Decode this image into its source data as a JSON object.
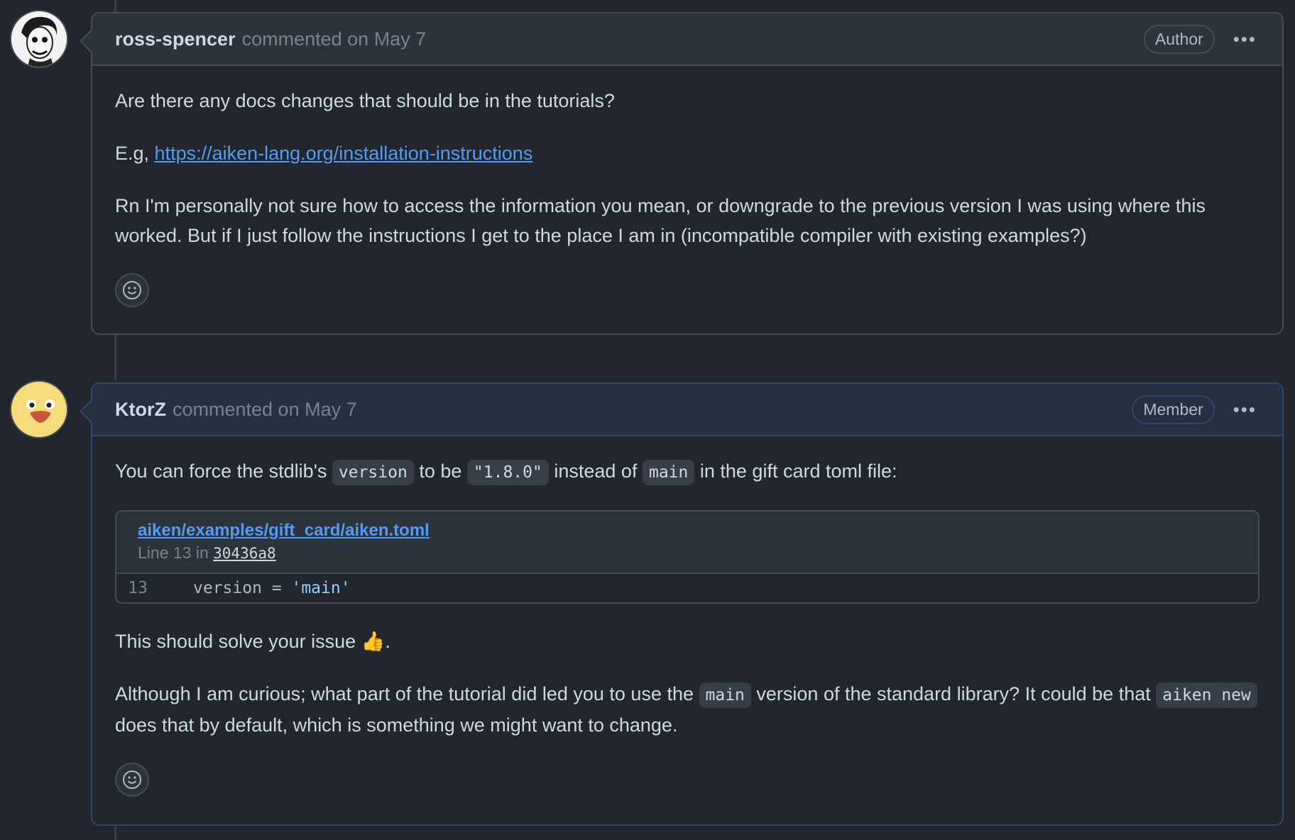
{
  "colors": {
    "background": "#22272e",
    "header_bg": "#2d333b",
    "member_header_bg": "#253040",
    "link": "#539bf5",
    "border": "#444c56"
  },
  "comments": [
    {
      "author": "ross-spencer",
      "meta": "commented on May 7",
      "role": "Author",
      "menu_icon": "kebab-horizontal-icon",
      "body": {
        "p1": "Are there any docs changes that should be in the tutorials?",
        "p2_prefix": "E.g,",
        "p2_link": "https://aiken-lang.org/installation-instructions",
        "p3": "Rn I'm personally not sure how to access the information you mean, or downgrade to the previous version I was using where this worked. But if I just follow the instructions I get to the place I am in (incompatible compiler with existing examples?)"
      },
      "reaction_icon": "smiley-icon"
    },
    {
      "author": "KtorZ",
      "meta": "commented on May 7",
      "role": "Member",
      "menu_icon": "kebab-horizontal-icon",
      "body": {
        "p1_a": "You can force the stdlib's",
        "p1_code1": "version",
        "p1_b": "to be",
        "p1_code2": "\"1.8.0\"",
        "p1_c": "instead of",
        "p1_code3": "main",
        "p1_d": "in the gift card toml file:",
        "snippet": {
          "file": "aiken/examples/gift_card/aiken.toml",
          "line_prefix": "Line 13 in",
          "sha": "30436a8",
          "line_number": "13",
          "code_key": "version = ",
          "code_value": "'main'"
        },
        "p2": "This should solve your issue",
        "p2_emoji": "👍",
        "p2_end": ".",
        "p3_a": "Although I am curious; what part of the tutorial did led you to use the",
        "p3_code1": "main",
        "p3_b": "version of the standard library? It could be that",
        "p3_code2": "aiken new",
        "p3_c": "does that by default, which is something we might want to change."
      },
      "reaction_icon": "smiley-icon"
    }
  ]
}
